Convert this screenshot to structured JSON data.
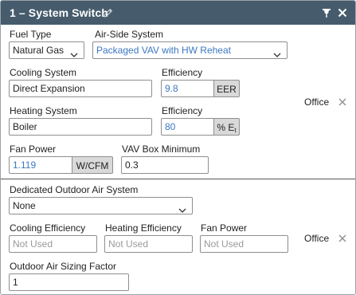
{
  "header": {
    "title": "1 – System Switch",
    "icons": {
      "edit": "pencil-icon",
      "pin": "pin-icon",
      "close": "close-icon"
    }
  },
  "system": {
    "fuel_type_label": "Fuel Type",
    "fuel_type_value": "Natural Gas",
    "air_side_label": "Air-Side System",
    "air_side_value": "Packaged VAV with HW Reheat",
    "cooling_system_label": "Cooling System",
    "cooling_system_value": "Direct Expansion",
    "cooling_eff_label": "Efficiency",
    "cooling_eff_value": "9.8",
    "cooling_eff_unit": "EER",
    "heating_system_label": "Heating System",
    "heating_system_value": "Boiler",
    "heating_eff_label": "Efficiency",
    "heating_eff_value": "80",
    "heating_eff_unit": "% E",
    "heating_eff_unit_sub": "t",
    "fan_power_label": "Fan Power",
    "fan_power_value": "1.119",
    "fan_power_unit": "W/CFM",
    "vav_min_label": "VAV Box Minimum",
    "vav_min_value": "0.3",
    "zone_label": "Office"
  },
  "doas": {
    "label": "Dedicated Outdoor Air System",
    "value": "None",
    "cooling_eff_label": "Cooling Efficiency",
    "cooling_eff_placeholder": "Not Used",
    "heating_eff_label": "Heating Efficiency",
    "heating_eff_placeholder": "Not Used",
    "fan_power_label": "Fan Power",
    "fan_power_placeholder": "Not Used",
    "zone_label": "Office",
    "sizing_label": "Outdoor Air Sizing Factor",
    "sizing_value": "1"
  },
  "colors": {
    "titlebar": "#465c6c",
    "value_blue": "#3b78c2",
    "unit_gray": "#d9d9d9"
  }
}
